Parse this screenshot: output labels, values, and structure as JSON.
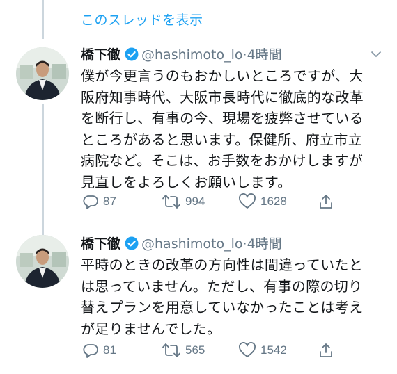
{
  "thread_link": "このスレッドを表示",
  "tweets": [
    {
      "author_name": "橋下徹",
      "handle": "@hashimoto_lo",
      "separator": "·",
      "time": "4時間",
      "lines": [
        "僕が今更言うのもおかしいところですが、大",
        "阪府知事時代、大阪市長時代に徹底的な改革",
        "を断行し、有事の今、現場を疲弊させている",
        "ところがあると思います。保健所、府立市立",
        "病院など。そこは、お手数をおかけしますが",
        "見直しをよろしくお願いします。"
      ],
      "replies": "87",
      "retweets": "994",
      "likes": "1628"
    },
    {
      "author_name": "橋下徹",
      "handle": "@hashimoto_lo",
      "separator": "·",
      "time": "4時間",
      "lines": [
        "平時のときの改革の方向性は間違っていたと",
        "は思っていません。ただし、有事の際の切り",
        "替えプランを用意していなかったことは考え",
        "が足りませんでした。"
      ],
      "replies": "81",
      "retweets": "565",
      "likes": "1542"
    }
  ],
  "icons": {
    "verified": "verified-badge-icon",
    "caret": "chevron-down-icon",
    "reply": "reply-icon",
    "retweet": "retweet-icon",
    "like": "heart-icon",
    "share": "share-icon"
  },
  "colors": {
    "accent": "#1da1f2",
    "secondary_text": "#657786",
    "thread_line": "#ccd6dd"
  }
}
